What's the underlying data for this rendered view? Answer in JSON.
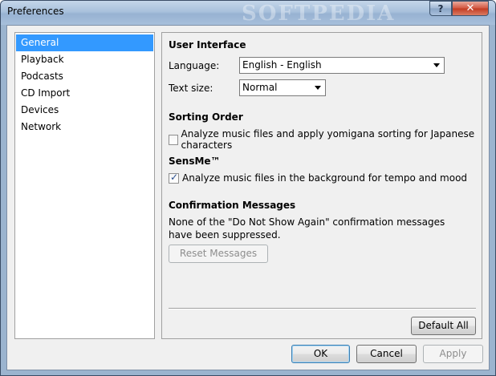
{
  "window": {
    "title": "Preferences",
    "watermark": "SOFTPEDIA",
    "help_label": "?",
    "close_label": "✕"
  },
  "sidebar": {
    "items": [
      {
        "label": "General"
      },
      {
        "label": "Playback"
      },
      {
        "label": "Podcasts"
      },
      {
        "label": "CD Import"
      },
      {
        "label": "Devices"
      },
      {
        "label": "Network"
      }
    ],
    "selected": "General"
  },
  "user_interface": {
    "title": "User Interface",
    "language_label": "Language:",
    "language_value": "English - English",
    "text_size_label": "Text size:",
    "text_size_value": "Normal"
  },
  "sorting_order": {
    "title": "Sorting Order",
    "checkbox_label": "Analyze music files and apply yomigana sorting for Japanese characters",
    "checked": false
  },
  "sensme": {
    "title": "SensMe™",
    "checkbox_label": "Analyze music files in the background for tempo and mood",
    "checked": true
  },
  "confirmation": {
    "title": "Confirmation Messages",
    "description": "None of the \"Do Not Show Again\" confirmation messages have been suppressed.",
    "reset_label": "Reset Messages"
  },
  "buttons": {
    "default_all": "Default All",
    "ok": "OK",
    "cancel": "Cancel",
    "apply": "Apply"
  }
}
